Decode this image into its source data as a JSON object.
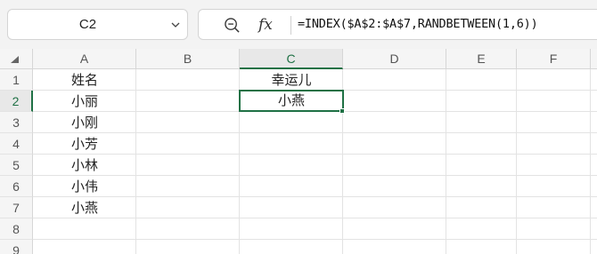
{
  "name_box": {
    "value": "C2"
  },
  "formula_bar": {
    "zoom_icon": "zoom-magnifier-icon",
    "fx_label": "fx",
    "formula": "=INDEX($A$2:$A$7,RANDBETWEEN(1,6))"
  },
  "columns": [
    "A",
    "B",
    "C",
    "D",
    "E",
    "F"
  ],
  "active_column": "C",
  "rows": [
    "1",
    "2",
    "3",
    "4",
    "5",
    "6",
    "7",
    "8",
    "9"
  ],
  "active_row": "2",
  "cells": {
    "A1": "姓名",
    "A2": "小丽",
    "A3": "小刚",
    "A4": "小芳",
    "A5": "小林",
    "A6": "小伟",
    "A7": "小燕",
    "C1": "幸运儿",
    "C2": "小燕"
  },
  "accent_color": "#1f7145"
}
